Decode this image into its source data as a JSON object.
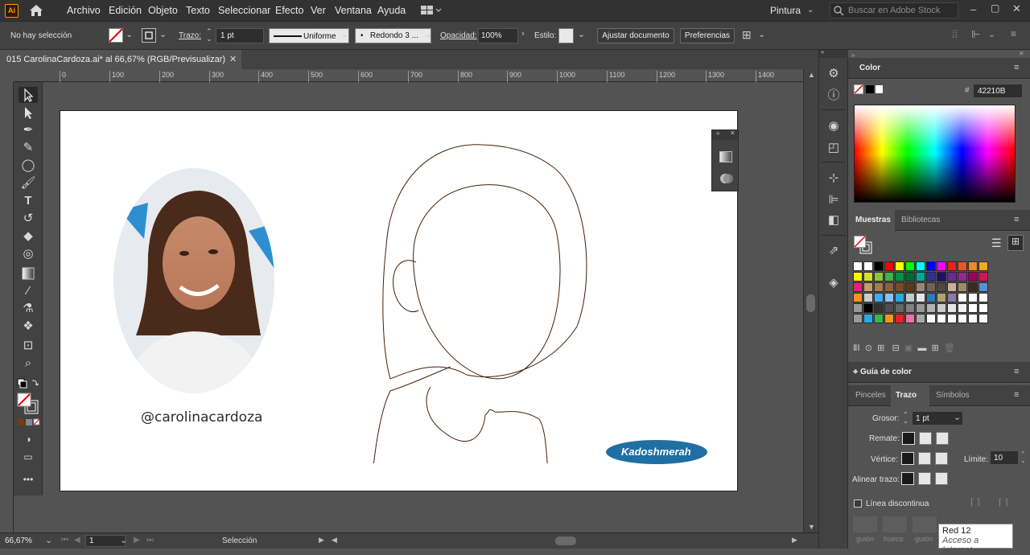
{
  "app": {
    "logo": "Ai"
  },
  "menu": [
    "Archivo",
    "Edición",
    "Objeto",
    "Texto",
    "Seleccionar",
    "Efecto",
    "Ver",
    "Ventana",
    "Ayuda"
  ],
  "workspace": "Pintura",
  "search": {
    "placeholder": "Buscar en Adobe Stock"
  },
  "control": {
    "selection": "No hay selección",
    "trazo_label": "Trazo:",
    "trazo_value": "1 pt",
    "stroke_style": "Uniforme",
    "brush": "Redondo 3 ...",
    "opacity_label": "Opacidad:",
    "opacity_value": "100%",
    "style_label": "Estilo:",
    "adjust_doc": "Ajustar documento",
    "prefs": "Preferencias"
  },
  "document": {
    "tab_title": "015 CarolinaCardoza.ai* al 66,67% (RGB/Previsualizar)"
  },
  "ruler_ticks": [
    "0",
    "100",
    "200",
    "300",
    "400",
    "500",
    "600",
    "700",
    "800",
    "900",
    "1000",
    "1100",
    "1200",
    "1300",
    "1400"
  ],
  "artwork": {
    "handle": "@carolinacardoza",
    "signature": "Kadoshmerah",
    "ellipse_color": "#1f6fa3",
    "stroke_color": "#42210B"
  },
  "status": {
    "zoom": "66,67%",
    "page": "1",
    "tool": "Selección"
  },
  "color_panel": {
    "title": "Color",
    "hex": "42210B"
  },
  "swatches_panel": {
    "tab_active": "Muestras",
    "tab_other": "Bibliotecas",
    "rows": [
      [
        "#ffffff",
        "#ffffff",
        "#000000",
        "#ff0000",
        "#ffff00",
        "#00ff00",
        "#00ffff",
        "#0000ff",
        "#ff00ff",
        "#e6231c",
        "#e9562b",
        "#f08a24",
        "#f5a623"
      ],
      [
        "#fff200",
        "#d7df23",
        "#8cc63f",
        "#39b54a",
        "#009245",
        "#006837",
        "#00a99d",
        "#2e3192",
        "#1b1464",
        "#662d91",
        "#93278f",
        "#9e005d",
        "#d4145a"
      ],
      [
        "#ed1e79",
        "#c69c6d",
        "#a67c52",
        "#8c6239",
        "#754c24",
        "#603813",
        "#998675",
        "#736357",
        "#534741",
        "#c7b299",
        "#a0896a",
        "#3d2b1f",
        "#5a8fd1"
      ],
      [
        "#f7931e",
        "#cccccc",
        "#3fa9f5",
        "#8bc3f0",
        "#29abe2",
        "#bdccd4",
        "#e6e6e6",
        "#2b7bb9",
        "#b4a26a",
        "#8c7aa9",
        "#ffffff",
        "#ffffff",
        "#ffffff"
      ],
      [
        "#999999",
        "#000000",
        "#333333",
        "#4d4d4d",
        "#666666",
        "#808080",
        "#999999",
        "#b3b3b3",
        "#cccccc",
        "#e6e6e6",
        "#f2f2f2",
        "#ffffff",
        "#ffffff"
      ],
      [
        "#999999",
        "#29abe2",
        "#39b54a",
        "#f7931e",
        "#ed1e24",
        "#f06eaa",
        "#a7a9ac",
        "#ffffff",
        "#ffffff",
        "#ffffff",
        "#ffffff",
        "#ffffff",
        "#ffffff"
      ]
    ]
  },
  "guide_panel": {
    "title": "Guía de color"
  },
  "stroke_panel": {
    "tab_pinceles": "Pinceles",
    "tab_trazo": "Trazo",
    "tab_simbolos": "Símbolos",
    "grosor_label": "Grosor:",
    "grosor_value": "1 pt",
    "remate_label": "Remate:",
    "vertice_label": "Vértice:",
    "limite_label": "Límite:",
    "limite_value": "10",
    "alinear_label": "Alinear trazo:",
    "dashed_label": "Línea discontinua",
    "gap1": "guión",
    "gap2": "hueco",
    "gap3": "guión"
  },
  "tooltip": {
    "line1": "Red  12",
    "line2": "Acceso a Internet"
  }
}
